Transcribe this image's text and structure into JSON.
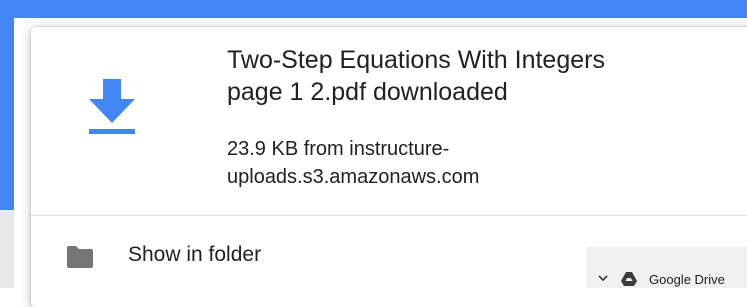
{
  "download": {
    "title_line1": "Two-Step Equations With Integers",
    "title_line2": "page 1 2.pdf downloaded",
    "source_line1": "23.9 KB from instructure-",
    "source_line2": "uploads.s3.amazonaws.com",
    "icon": "download-arrow-icon"
  },
  "actions": {
    "show_in_folder_label": "Show in folder",
    "folder_icon": "folder-icon"
  },
  "drive_chip": {
    "label": "Google Drive",
    "chevron_icon": "chevron-down-icon",
    "drive_icon": "google-drive-icon"
  },
  "colors": {
    "accent_blue": "#4285f4",
    "text": "#212121",
    "icon_grey": "#757575",
    "divider": "#e0e0e0"
  }
}
